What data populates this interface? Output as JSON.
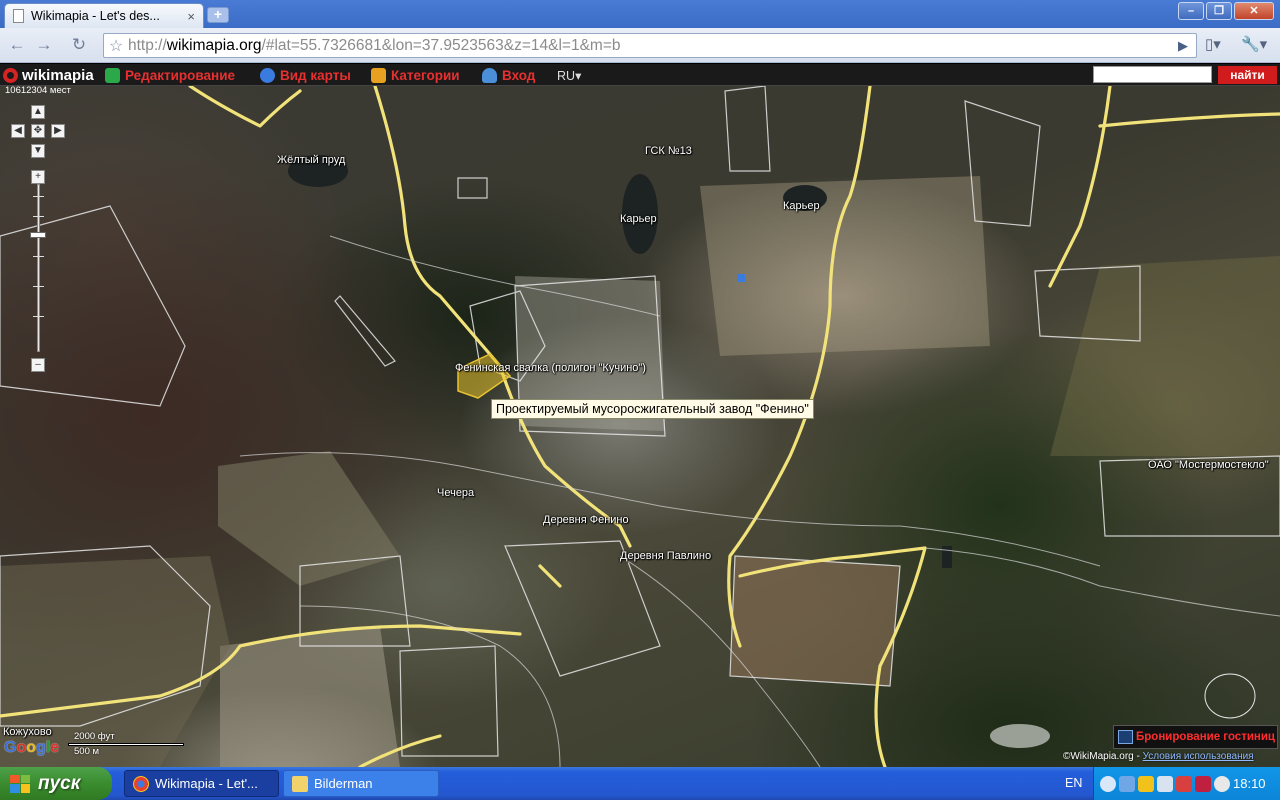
{
  "browser": {
    "tab_title": "Wikimapia - Let's des...",
    "tab_close": "×",
    "new_tab": "+",
    "url_scheme": "http://",
    "url_host": "wikimapia.org",
    "url_rest": "/#lat=55.7326681&lon=37.9523563&z=14&l=1&m=b"
  },
  "wikimapia": {
    "logo_text": "wikimapia",
    "menu": [
      {
        "label": "Редактирование",
        "icon": "edit-icon",
        "color": "#2aa84a"
      },
      {
        "label": "Вид карты",
        "icon": "compass-icon",
        "color": "#3a7be0"
      },
      {
        "label": "Категории",
        "icon": "categories-icon",
        "color": "#e8a020"
      },
      {
        "label": "Вход",
        "icon": "user-icon",
        "color": "#4a8fd8"
      }
    ],
    "language": "RU",
    "search_value": "",
    "find_button": "найти",
    "visits_counter": "10612304 мест"
  },
  "map": {
    "labels": {
      "yellow_pond": "Жёлтый пруд",
      "gsk13": "ГСК №13",
      "quarry1": "Карьер",
      "quarry2": "Карьер",
      "landfill": "Фенинская свалка (полигон \"Кучино\")",
      "checher": "Чечера",
      "fenino": "Деревня Фенино",
      "pavlino": "Деревня Павлино",
      "mostermostek": "ОАО \"Мостермостекло\"",
      "kozhukhovo": "Кожухово"
    },
    "tooltip": "Проектируемый мусоросжигательный завод \"Фенино\"",
    "scale_ft": "2000 фут",
    "scale_m": "500 м",
    "hotel_banner": "Бронирование гостиниц",
    "copyright": "©WikiMapia.org",
    "copyright_sep": " - ",
    "terms": "Условия использования",
    "google": [
      "G",
      "o",
      "o",
      "g",
      "l",
      "e"
    ],
    "highlight_color": "#e8c22e",
    "road_color": "#f2e27a"
  },
  "taskbar": {
    "start_label": "пуск",
    "tasks": [
      {
        "label": "Wikimapia - Let'..."
      },
      {
        "label": "Bilderman"
      }
    ],
    "language": "EN",
    "clock": "18:10"
  }
}
